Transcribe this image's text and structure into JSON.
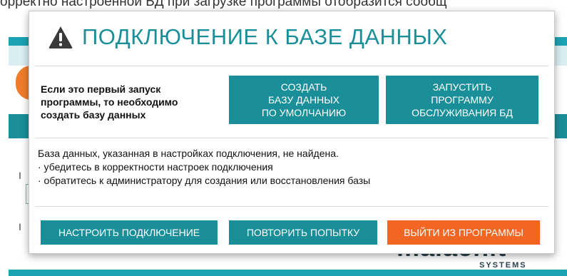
{
  "background": {
    "caption": "орректно настроенной БД при загрузке программы отобразится сообщ",
    "brand_main": "malachit",
    "brand_sub": "SYSTEMS"
  },
  "dialog": {
    "title": "ПОДКЛЮЧЕНИЕ К БАЗЕ ДАННЫХ",
    "first_run_text": "Если это первый запуск программы, то необходимо создать базу данных",
    "create_db_button": "СОЗДАТЬ\nБАЗУ ДАННЫХ\nПО УМОЛЧАНИЮ",
    "launch_service_button": "ЗАПУСТИТЬ\nПРОГРАММУ\nОБСЛУЖИВАНИЯ БД",
    "message": "База данных, указанная в настройках подключения, не найдена.\n· убедитесь в корректности настроек подключения\n· обратитесь к администратору для создания или восстановления базы",
    "configure_button": "НАСТРОИТЬ ПОДКЛЮЧЕНИЕ",
    "retry_button": "ПОВТОРИТЬ ПОПЫТКУ",
    "exit_button": "ВЫЙТИ ИЗ ПРОГРАММЫ"
  },
  "colors": {
    "teal": "#1a8f99",
    "orange": "#f26522",
    "warning_icon": "#3a3a3a"
  },
  "icons": {
    "title_icon": "warning-triangle-icon"
  }
}
